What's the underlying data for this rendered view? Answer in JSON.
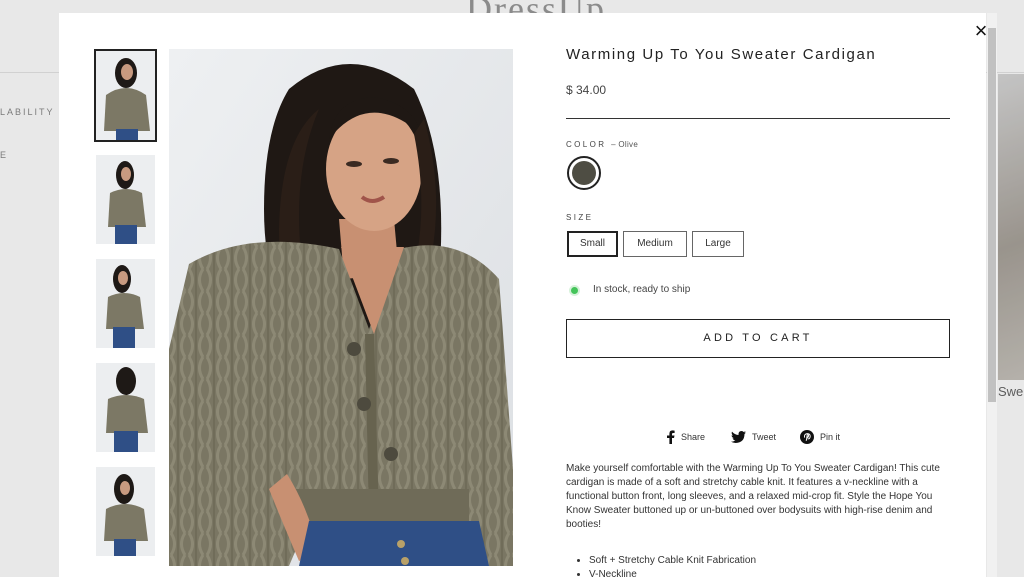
{
  "background": {
    "logo": "DressUp",
    "left_label_1": "LABILITY",
    "left_label_2": "E",
    "right_card_text": "Swe"
  },
  "modal": {
    "close_icon": "×",
    "thumbnails_count": 5,
    "main_image_alt": "Model wearing olive cable knit cardigan"
  },
  "product": {
    "title": "Warming Up To You Sweater Cardigan",
    "price": "$ 34.00",
    "color_label": "COLOR",
    "color_value": "– Olive",
    "color_hex": "#4e4d43",
    "size_label": "SIZE",
    "sizes": [
      "Small",
      "Medium",
      "Large"
    ],
    "selected_size": "Small",
    "stock_text": "In stock, ready to ship",
    "stock_color": "#44c45a",
    "add_to_cart": "ADD TO CART"
  },
  "share": {
    "facebook": "Share",
    "twitter": "Tweet",
    "pinterest": "Pin it"
  },
  "description": {
    "text": "Make yourself comfortable with the Warming Up To You Sweater Cardigan! This cute cardigan is made of a soft and stretchy cable knit. It features a v-neckline with a functional button front, long sleeves, and a relaxed mid-crop fit. Style the Hope You Know Sweater buttoned up or un-buttoned over bodysuits with high-rise denim and booties!",
    "bullets": [
      "Soft + Stretchy Cable Knit Fabrication",
      "V-Neckline"
    ]
  }
}
